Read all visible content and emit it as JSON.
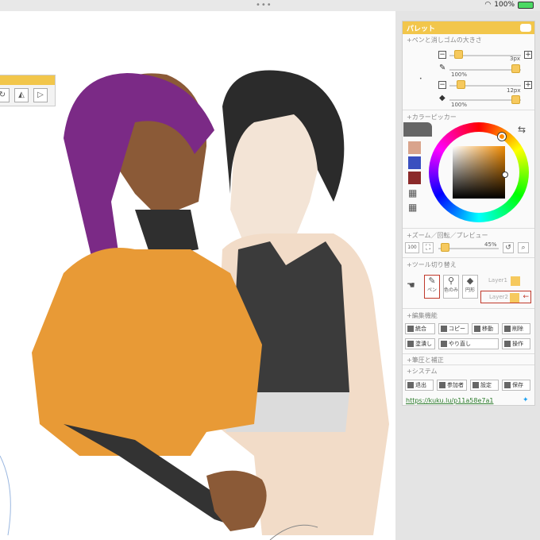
{
  "status": {
    "battery": "100%"
  },
  "panel": {
    "title": "パレット",
    "sections": {
      "pen_eraser_size": "+ペンと消しゴムの大きさ",
      "color_picker": "+カラーピッカー",
      "zoom": "+ズーム／回転／プレビュー",
      "tool_switch": "+ツール切り替え",
      "edit": "+編集機能",
      "pressure": "+筆圧と補正",
      "system": "+システム"
    },
    "pen": {
      "size": "3px",
      "opacity": "100%"
    },
    "eraser": {
      "size": "12px",
      "opacity": "100%"
    },
    "swatches": [
      "#d9a48c",
      "#3a4fbf",
      "#8b2a2a"
    ],
    "zoom": {
      "level": "45%",
      "label_100": "100"
    },
    "tools": {
      "pen": "ペン",
      "eyedrop": "色のみ",
      "shape": "円形"
    },
    "layers": {
      "layer1": "Layer1",
      "layer2": "Layer2"
    },
    "edit_buttons": {
      "merge": "統合",
      "copy": "コピー",
      "move": "移動",
      "delete": "削除",
      "fill": "塗潰し",
      "redo": "やり直し",
      "ops": "操作"
    },
    "system_buttons": {
      "leave": "退出",
      "members": "参加者",
      "settings": "設定",
      "save": "保存"
    },
    "url": "https://kuku.lu/p11a58e7a1"
  }
}
